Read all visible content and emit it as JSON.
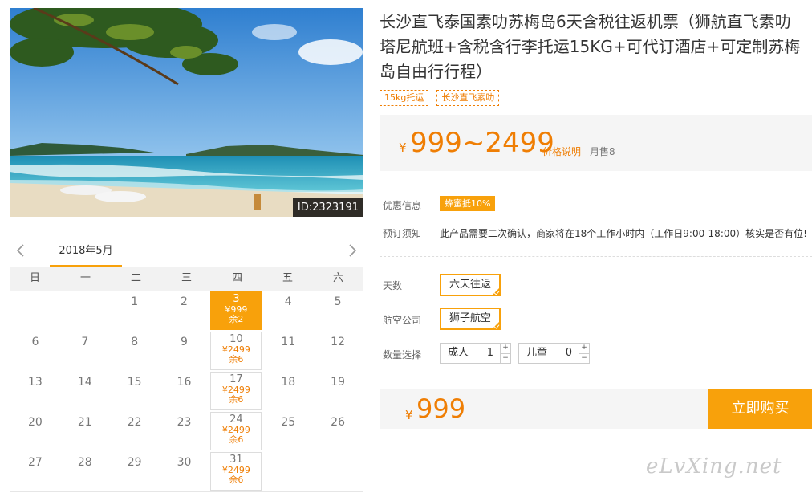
{
  "product": {
    "title": "长沙直飞泰国素叻苏梅岛6天含税往返机票（狮航直飞素叻塔尼航班+含税含行李托运15KG+可代订酒店+可定制苏梅岛自由行行程）",
    "tags": [
      "15kg托运",
      "长沙直飞素叻"
    ],
    "image_id": "ID:2323191"
  },
  "price": {
    "currency": "¥",
    "range": "999~2499",
    "explain_link": "价格说明",
    "monthly_sales": "月售8"
  },
  "info": {
    "promo_label": "优惠信息",
    "promo_badge": "蜂蜜抵10%",
    "notice_label": "预订须知",
    "notice_text": "此产品需要二次确认，商家将在18个工作小时内（工作日9:00-18:00）核实是否有位!"
  },
  "options": {
    "days_label": "天数",
    "days_value": "六天往返",
    "airline_label": "航空公司",
    "airline_value": "狮子航空",
    "qty_label": "数量选择",
    "adult_label": "成人",
    "adult_value": "1",
    "child_label": "儿童",
    "child_value": "0",
    "plus": "+",
    "minus": "−"
  },
  "total": {
    "currency": "¥",
    "amount": "999",
    "buy_label": "立即购买"
  },
  "calendar": {
    "month": "2018年5月",
    "weekdays": [
      "日",
      "一",
      "二",
      "三",
      "四",
      "五",
      "六"
    ],
    "rows": [
      [
        {
          "d": ""
        },
        {
          "d": ""
        },
        {
          "d": "1"
        },
        {
          "d": "2"
        },
        {
          "d": "3",
          "p": "¥999",
          "s": "余2",
          "sel": true
        },
        {
          "d": "4"
        },
        {
          "d": "5"
        }
      ],
      [
        {
          "d": "6"
        },
        {
          "d": "7"
        },
        {
          "d": "8"
        },
        {
          "d": "9"
        },
        {
          "d": "10",
          "p": "¥2499",
          "s": "余6"
        },
        {
          "d": "11"
        },
        {
          "d": "12"
        }
      ],
      [
        {
          "d": "13"
        },
        {
          "d": "14"
        },
        {
          "d": "15"
        },
        {
          "d": "16"
        },
        {
          "d": "17",
          "p": "¥2499",
          "s": "余6"
        },
        {
          "d": "18"
        },
        {
          "d": "19"
        }
      ],
      [
        {
          "d": "20"
        },
        {
          "d": "21"
        },
        {
          "d": "22"
        },
        {
          "d": "23"
        },
        {
          "d": "24",
          "p": "¥2499",
          "s": "余6"
        },
        {
          "d": "25"
        },
        {
          "d": "26"
        }
      ],
      [
        {
          "d": "27"
        },
        {
          "d": "28"
        },
        {
          "d": "29"
        },
        {
          "d": "30"
        },
        {
          "d": "31",
          "p": "¥2499",
          "s": "余6"
        },
        {
          "d": ""
        },
        {
          "d": ""
        }
      ]
    ]
  },
  "watermark": "eLvXing.net",
  "colors": {
    "accent": "#f8a10b",
    "price": "#ef7e04",
    "panel": "#f5f5f5"
  }
}
